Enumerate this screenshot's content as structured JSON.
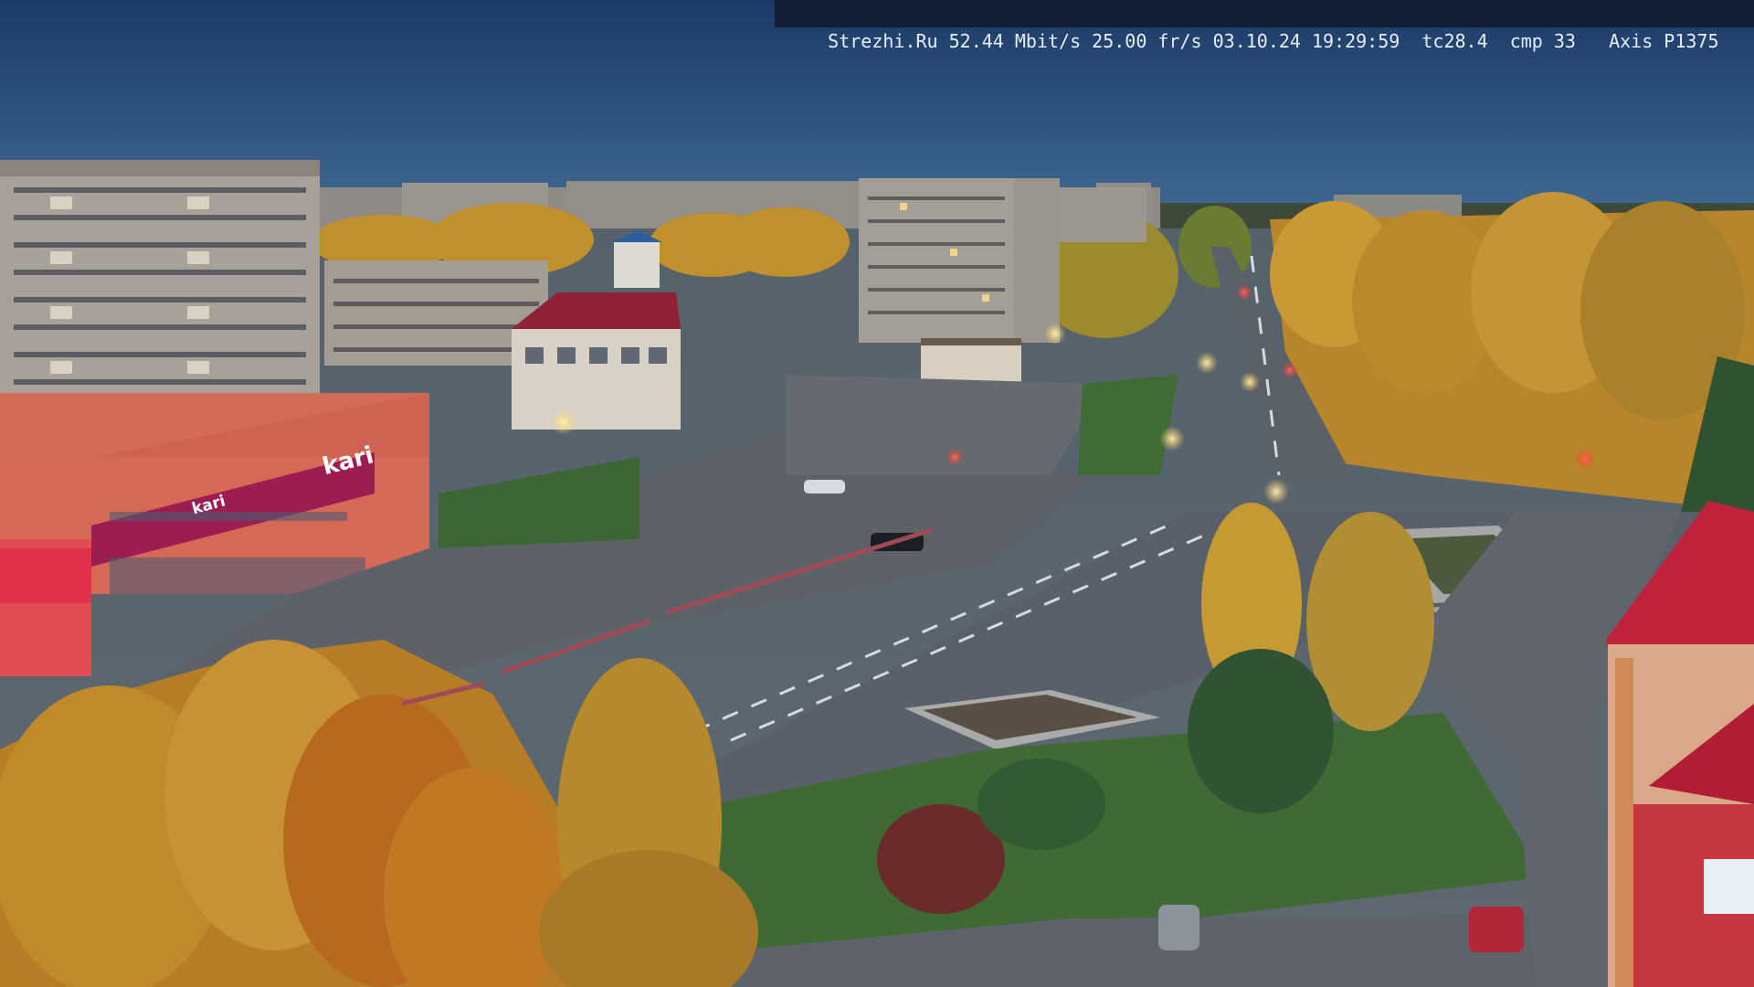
{
  "camera_overlay": {
    "text": "Strezhi.Ru 52.44 Mbit/s 25.00 fr/s 03.10.24 19:29:59  tc28.4  cmp 33   Axis P1375"
  },
  "storefront": {
    "sign_large": "kari",
    "sign_small": "kari"
  },
  "colors": {
    "sky_top": "#1c3a66",
    "sky_horizon": "#3f6a92",
    "road": "#5e646c",
    "autumn_foliage": "#c8962e",
    "grass": "#3e6a34",
    "red_roof": "#b32435"
  }
}
